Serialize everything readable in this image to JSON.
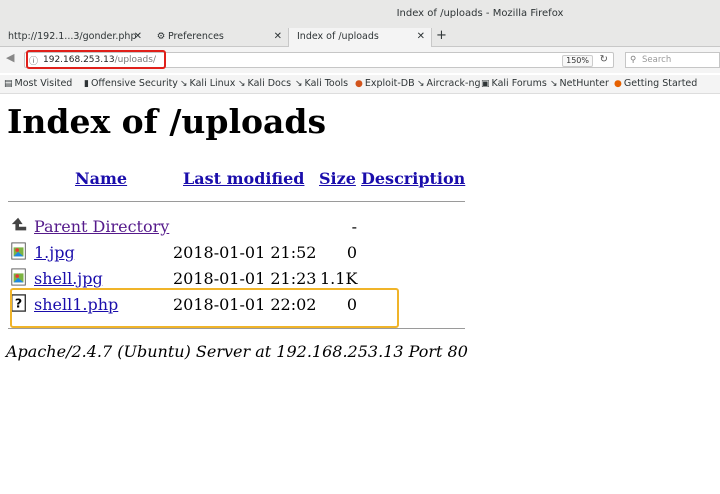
{
  "window": {
    "title": "Index of /uploads - Mozilla Firefox"
  },
  "tabs": [
    {
      "label": "http://192.1...3/gonder.php",
      "icon": "none"
    },
    {
      "label": "Preferences",
      "icon": "gear-icon"
    },
    {
      "label": "Index of /uploads",
      "icon": "none",
      "active": true
    }
  ],
  "navbar": {
    "url_host": "192.168.253.13",
    "url_path": "/uploads/",
    "zoom": "150%",
    "search_placeholder": "Search"
  },
  "bookmarks": [
    "Most Visited",
    "Offensive Security",
    "Kali Linux",
    "Kali Docs",
    "Kali Tools",
    "Exploit-DB",
    "Aircrack-ng",
    "Kali Forums",
    "NetHunter",
    "Getting Started"
  ],
  "page": {
    "heading": "Index of /uploads",
    "columns": {
      "name": "Name",
      "last_modified": "Last modified",
      "size": "Size",
      "description": "Description"
    },
    "parent": {
      "name": "Parent Directory",
      "size": "-"
    },
    "files": [
      {
        "name": "1.jpg",
        "modified": "2018-01-01 21:52",
        "size": "0",
        "icon": "image-file-icon"
      },
      {
        "name": "shell.jpg",
        "modified": "2018-01-01 21:23",
        "size": "1.1K",
        "icon": "image-file-icon"
      },
      {
        "name": "shell1.php",
        "modified": "2018-01-01 22:02",
        "size": "0",
        "icon": "unknown-file-icon"
      }
    ],
    "footer": "Apache/2.4.7 (Ubuntu) Server at 192.168.253.13 Port 80"
  },
  "highlight_colors": {
    "url_box": "#e0201a",
    "file_box": "#f0b429"
  }
}
